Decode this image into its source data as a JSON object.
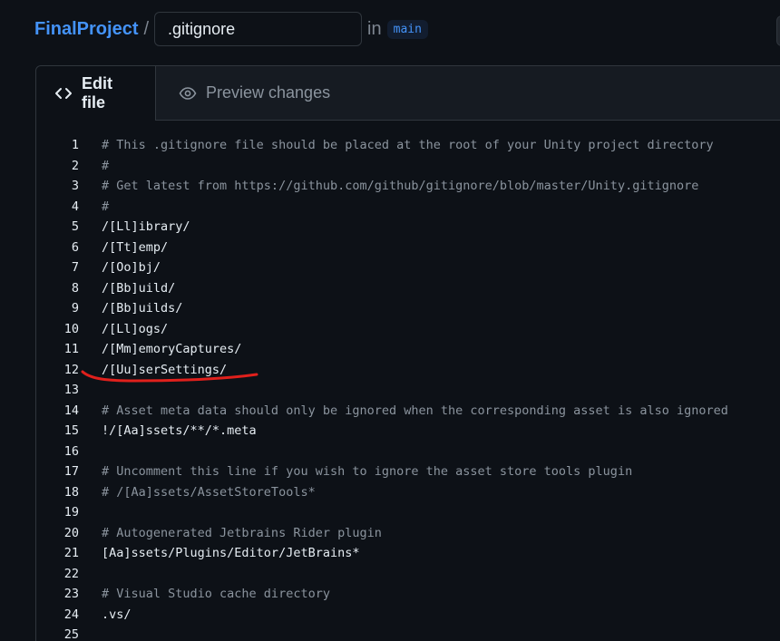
{
  "header": {
    "repo_name": "FinalProject",
    "separator": "/",
    "filename_value": ".gitignore",
    "in_label": "in",
    "branch": "main"
  },
  "tabs": {
    "edit_label": "Edit file",
    "preview_label": "Preview changes",
    "edit_icon": "code-icon",
    "preview_icon": "eye-icon"
  },
  "colors": {
    "accent": "#4493f8",
    "background": "#0d1117",
    "annotation": "#e0201c"
  },
  "code_lines": [
    {
      "num": "1",
      "text": "# This .gitignore file should be placed at the root of your Unity project directory",
      "comment": true
    },
    {
      "num": "2",
      "text": "#",
      "comment": true
    },
    {
      "num": "3",
      "text": "# Get latest from https://github.com/github/gitignore/blob/master/Unity.gitignore",
      "comment": true
    },
    {
      "num": "4",
      "text": "#",
      "comment": true
    },
    {
      "num": "5",
      "text": "/[Ll]ibrary/",
      "comment": false
    },
    {
      "num": "6",
      "text": "/[Tt]emp/",
      "comment": false
    },
    {
      "num": "7",
      "text": "/[Oo]bj/",
      "comment": false
    },
    {
      "num": "8",
      "text": "/[Bb]uild/",
      "comment": false
    },
    {
      "num": "9",
      "text": "/[Bb]uilds/",
      "comment": false
    },
    {
      "num": "10",
      "text": "/[Ll]ogs/",
      "comment": false
    },
    {
      "num": "11",
      "text": "/[Mm]emoryCaptures/",
      "comment": false
    },
    {
      "num": "12",
      "text": "/[Uu]serSettings/",
      "comment": false
    },
    {
      "num": "13",
      "text": "",
      "comment": false
    },
    {
      "num": "14",
      "text": "# Asset meta data should only be ignored when the corresponding asset is also ignored",
      "comment": true
    },
    {
      "num": "15",
      "text": "!/[Aa]ssets/**/*.meta",
      "comment": false
    },
    {
      "num": "16",
      "text": "",
      "comment": false
    },
    {
      "num": "17",
      "text": "# Uncomment this line if you wish to ignore the asset store tools plugin",
      "comment": true
    },
    {
      "num": "18",
      "text": "# /[Aa]ssets/AssetStoreTools*",
      "comment": true
    },
    {
      "num": "19",
      "text": "",
      "comment": false
    },
    {
      "num": "20",
      "text": "# Autogenerated Jetbrains Rider plugin",
      "comment": true
    },
    {
      "num": "21",
      "text": "[Aa]ssets/Plugins/Editor/JetBrains*",
      "comment": false
    },
    {
      "num": "22",
      "text": "",
      "comment": false
    },
    {
      "num": "23",
      "text": "# Visual Studio cache directory",
      "comment": true
    },
    {
      "num": "24",
      "text": ".vs/",
      "comment": false
    },
    {
      "num": "25",
      "text": "",
      "comment": false
    }
  ]
}
